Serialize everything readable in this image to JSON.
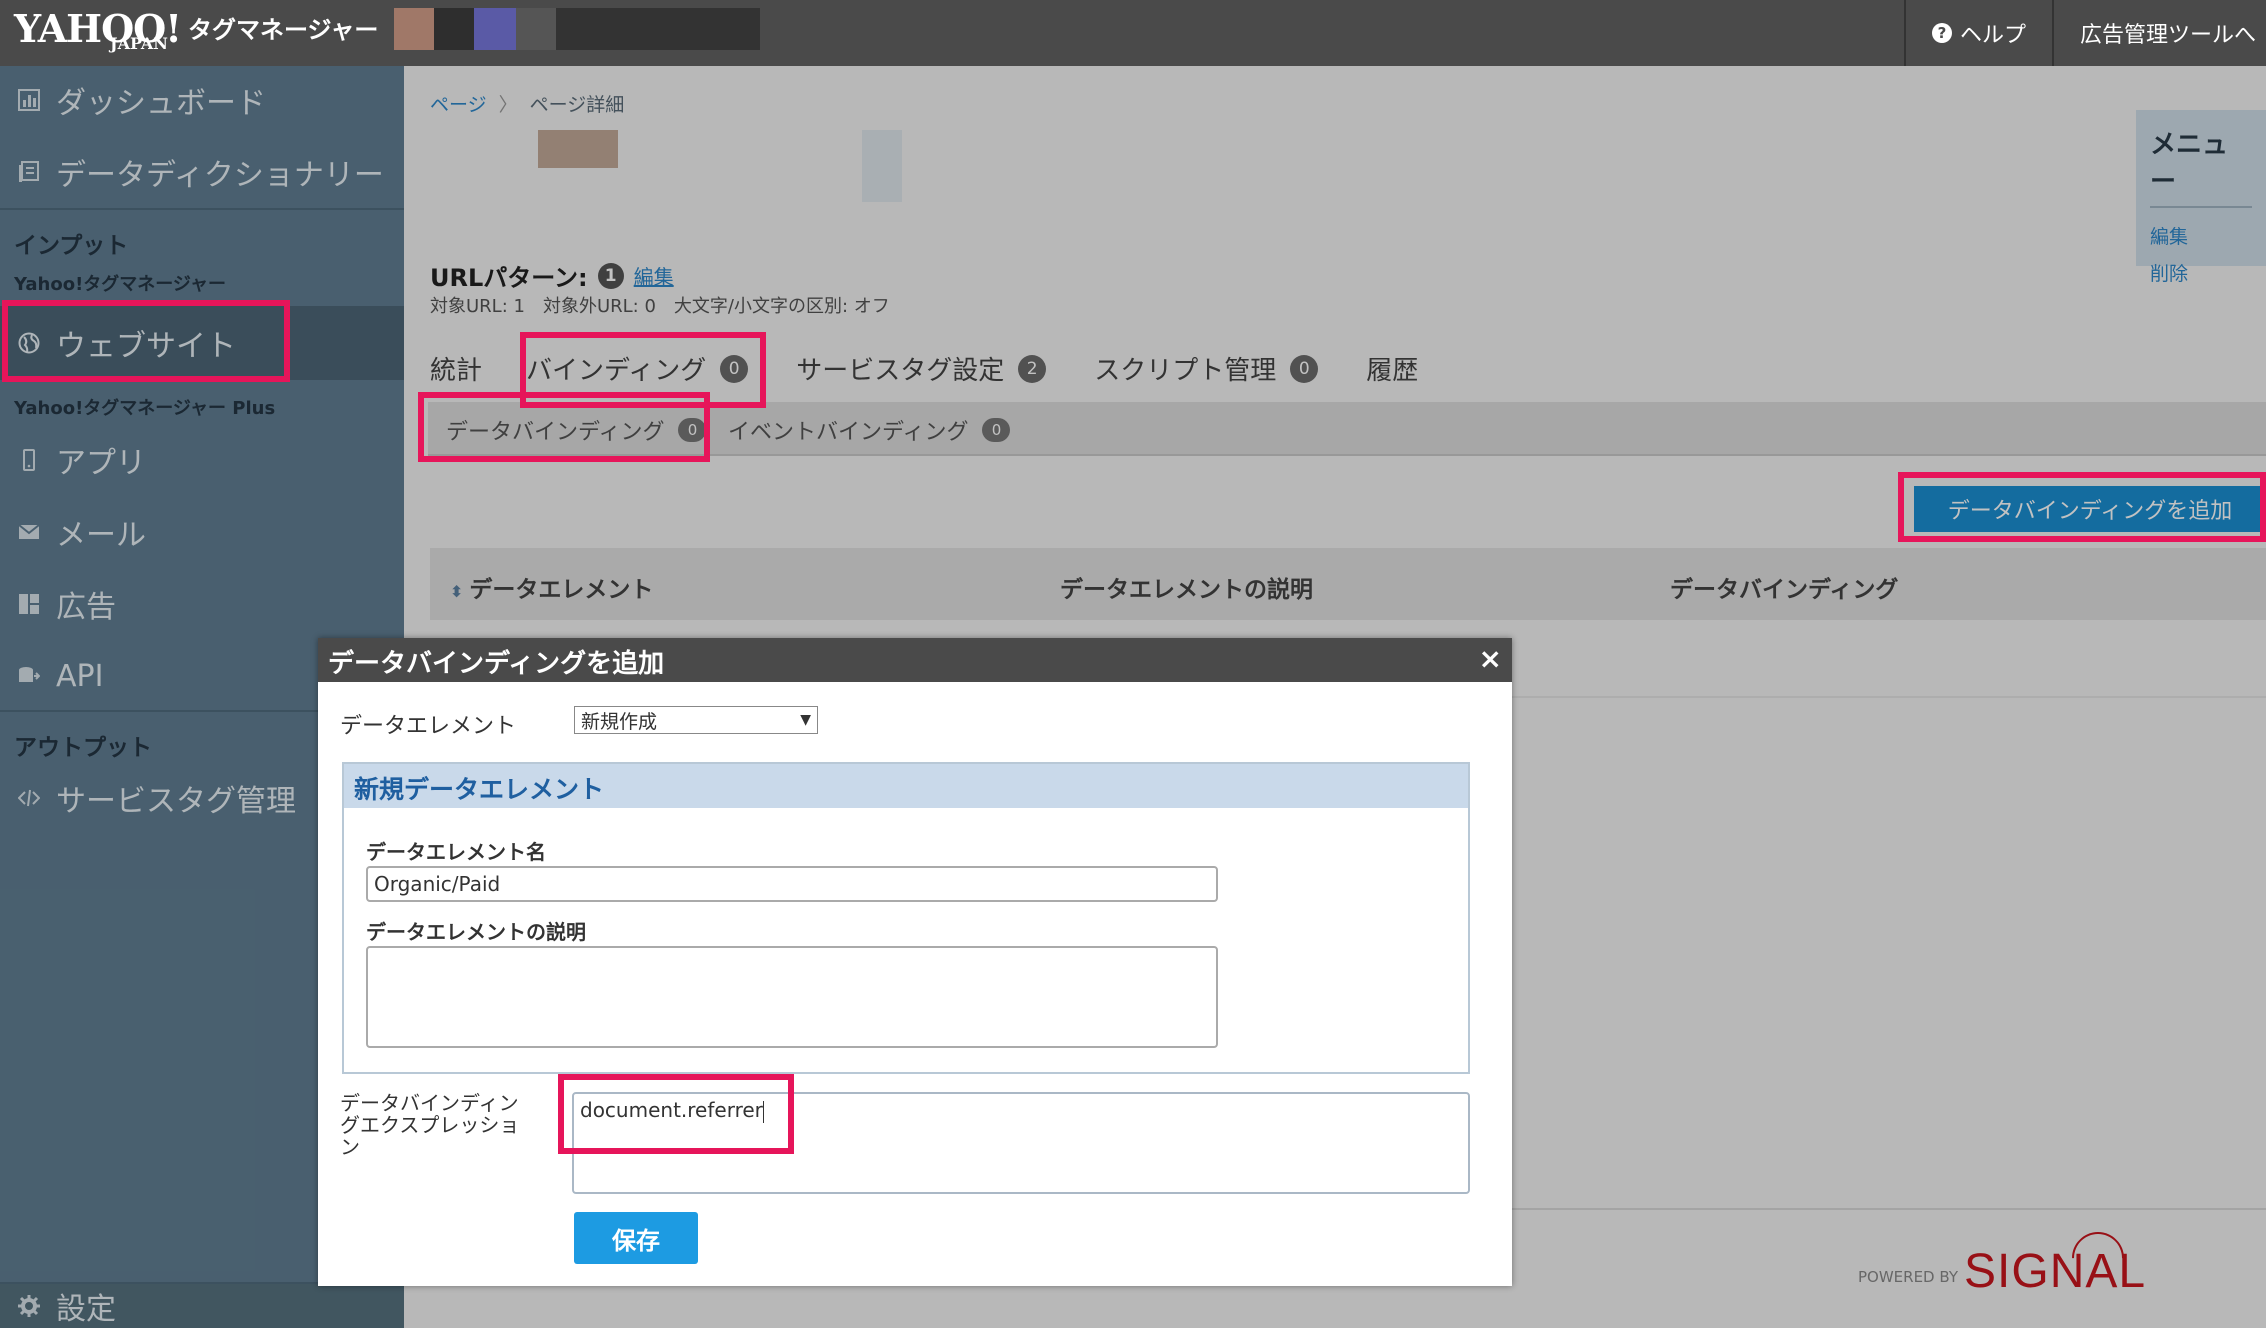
{
  "header": {
    "logo_main": "YAHOO!",
    "logo_sub": "JAPAN",
    "app_name": "タグマネージャー",
    "help_label": "ヘルプ",
    "ad_tool_label": "広告管理ツールへ",
    "colors": {
      "bar": "#4a4a4a"
    }
  },
  "sidebar": {
    "dashboard": "ダッシュボード",
    "data_dictionary": "データディクショナリー",
    "input_section": "インプット",
    "ytm_sub": "Yahoo!タグマネージャー",
    "website": "ウェブサイト",
    "ytm_plus_sub": "Yahoo!タグマネージャー Plus",
    "app": "アプリ",
    "mail": "メール",
    "ads": "広告",
    "api": "API",
    "output_section": "アウトプット",
    "service_tag": "サービスタグ管理",
    "settings": "設定",
    "colors": {
      "bg": "#607e92",
      "highlight": "#e6155a"
    }
  },
  "breadcrumb": {
    "root": "ページ",
    "current": "ページ詳細"
  },
  "menu_box": {
    "title": "メニュー",
    "edit": "編集",
    "delete": "削除"
  },
  "url_pattern": {
    "label": "URLパターン:",
    "count": "1",
    "edit": "編集",
    "meta": "対象URL: 1　対象外URL: 0　大文字/小文字の区別: オフ"
  },
  "tabs": [
    {
      "label": "統計",
      "badge": ""
    },
    {
      "label": "バインディング",
      "badge": "0"
    },
    {
      "label": "サービスタグ設定",
      "badge": "2"
    },
    {
      "label": "スクリプト管理",
      "badge": "0"
    },
    {
      "label": "履歴",
      "badge": ""
    }
  ],
  "subtabs": [
    {
      "label": "データバインディング",
      "badge": "0"
    },
    {
      "label": "イベントバインディング",
      "badge": "0"
    }
  ],
  "add_button": "データバインディングを追加",
  "table": {
    "col_element": "データエレメント",
    "col_desc": "データエレメントの説明",
    "col_binding": "データバインディング"
  },
  "footer": {
    "powered": "POWERED BY",
    "brand": "SIGNAL"
  },
  "modal": {
    "title": "データバインディングを追加",
    "close": "×",
    "element_label": "データエレメント",
    "element_select": "新規作成",
    "panel_title": "新規データエレメント",
    "name_label": "データエレメント名",
    "name_value": "Organic/Paid",
    "desc_label": "データエレメントの説明",
    "expr_label": "データバインディングエクスプレッション",
    "expr_value": "document.referrer",
    "save": "保存",
    "colors": {
      "save": "#1d9be2"
    }
  }
}
